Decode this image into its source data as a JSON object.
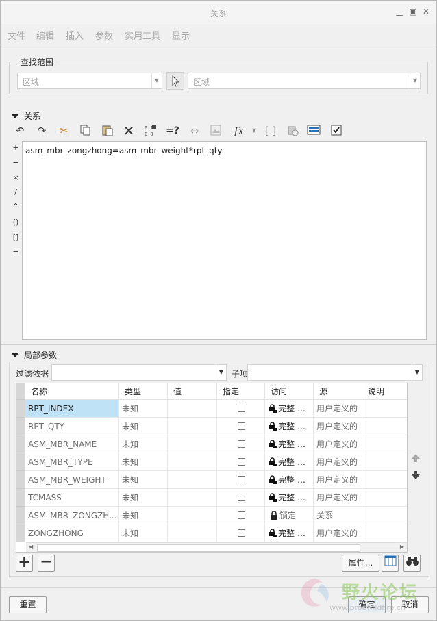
{
  "window": {
    "title": "关系"
  },
  "menu": [
    "文件",
    "编辑",
    "插入",
    "参数",
    "实用工具",
    "显示"
  ],
  "lookin": {
    "group_label": "查找范围",
    "scope_value": "区域",
    "item_value": "区域"
  },
  "relations": {
    "section_label": "关系",
    "toolbar_icons": [
      "undo-icon",
      "redo-icon",
      "cut-icon",
      "copy-icon",
      "paste-icon",
      "delete-icon",
      "sort-icon",
      "evaluate-icon",
      "dimension-icon",
      "image-icon",
      "function-icon",
      "brackets-icon",
      "param-icon",
      "display-icon",
      "verify-icon"
    ],
    "side_ops": [
      "+",
      "−",
      "×",
      "/",
      "^",
      "()",
      "[]",
      "="
    ],
    "text": "asm_mbr_zongzhong=asm_mbr_weight*rpt_qty"
  },
  "local_params": {
    "section_label": "局部参数",
    "filter_label": "过滤依据",
    "filter_value": "",
    "sub_label": "子项",
    "sub_value": "",
    "columns": [
      "名称",
      "类型",
      "值",
      "指定",
      "访问",
      "源",
      "说明"
    ],
    "rows": [
      {
        "name": "RPT_INDEX",
        "type": "未知",
        "value": "",
        "access": "完整",
        "source": "用户定义的",
        "selected": true,
        "locked": false
      },
      {
        "name": "RPT_QTY",
        "type": "未知",
        "value": "",
        "access": "完整",
        "source": "用户定义的",
        "selected": false,
        "locked": false
      },
      {
        "name": "ASM_MBR_NAME",
        "type": "未知",
        "value": "",
        "access": "完整",
        "source": "用户定义的",
        "selected": false,
        "locked": false
      },
      {
        "name": "ASM_MBR_TYPE",
        "type": "未知",
        "value": "",
        "access": "完整",
        "source": "用户定义的",
        "selected": false,
        "locked": false
      },
      {
        "name": "ASM_MBR_WEIGHT",
        "type": "未知",
        "value": "",
        "access": "完整",
        "source": "用户定义的",
        "selected": false,
        "locked": false
      },
      {
        "name": "TCMASS",
        "type": "未知",
        "value": "",
        "access": "完整",
        "source": "用户定义的",
        "selected": false,
        "locked": false
      },
      {
        "name": "ASM_MBR_ZONGZH...",
        "type": "未知",
        "value": "",
        "access": "锁定",
        "source": "关系",
        "selected": false,
        "locked": true
      },
      {
        "name": "ZONGZHONG",
        "type": "未知",
        "value": "",
        "access": "完整",
        "source": "用户定义的",
        "selected": false,
        "locked": false
      }
    ],
    "properties_label": "属性..."
  },
  "footer": {
    "reset_label": "重置",
    "ok_label": "确定",
    "cancel_label": "取消"
  },
  "watermark": {
    "text": "野火论坛",
    "url": "www.proewildfire.cn"
  }
}
